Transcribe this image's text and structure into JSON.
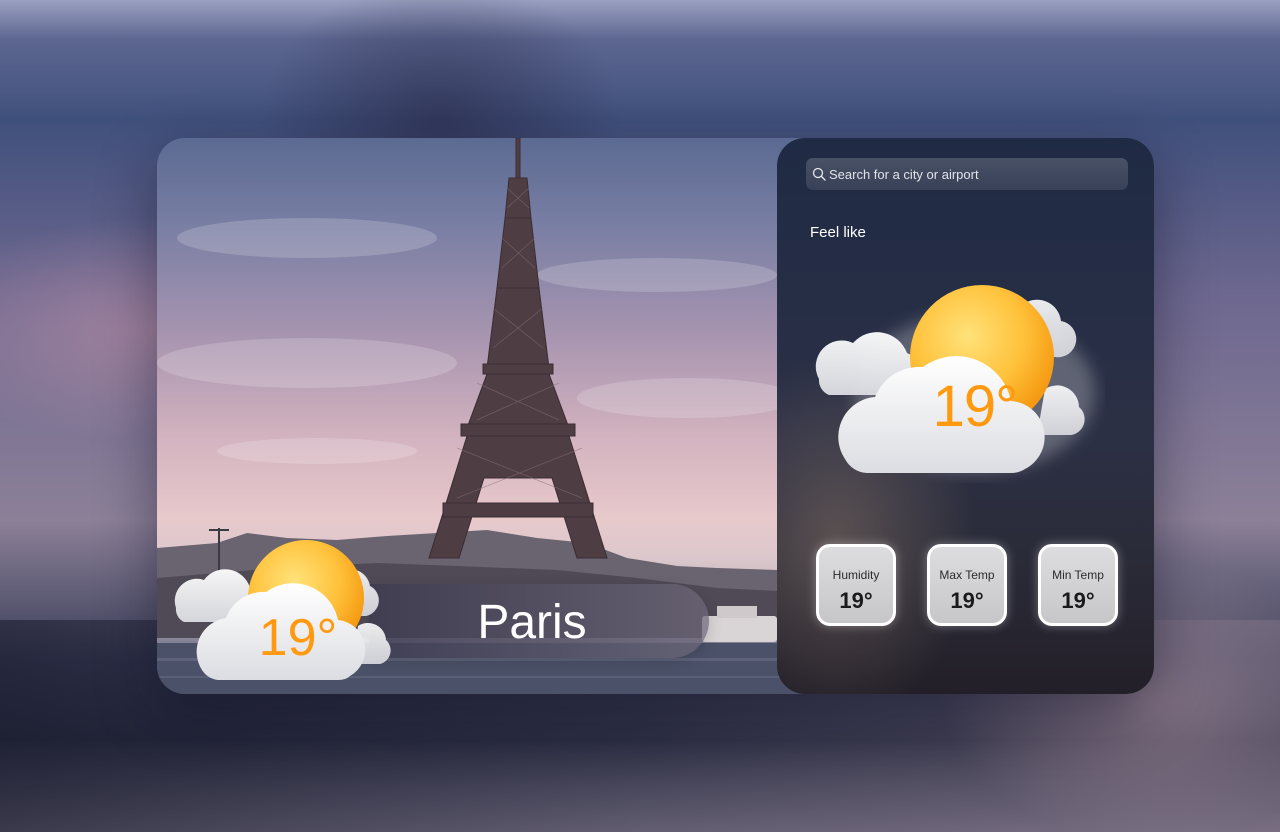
{
  "search": {
    "placeholder": "Search for a city or airport",
    "value": ""
  },
  "location": {
    "city": "Paris",
    "temperature": "19°"
  },
  "feels_like": {
    "title": "Feel like",
    "temperature": "19°",
    "condition_icon": "sun-behind-cloud-icon"
  },
  "stats": [
    {
      "label": "Humidity",
      "value": "19°"
    },
    {
      "label": "Max Temp",
      "value": "19°"
    },
    {
      "label": "Min Temp",
      "value": "19°"
    }
  ],
  "colors": {
    "temperature_accent": "#ff9a10",
    "panel_background": "#242d45"
  }
}
